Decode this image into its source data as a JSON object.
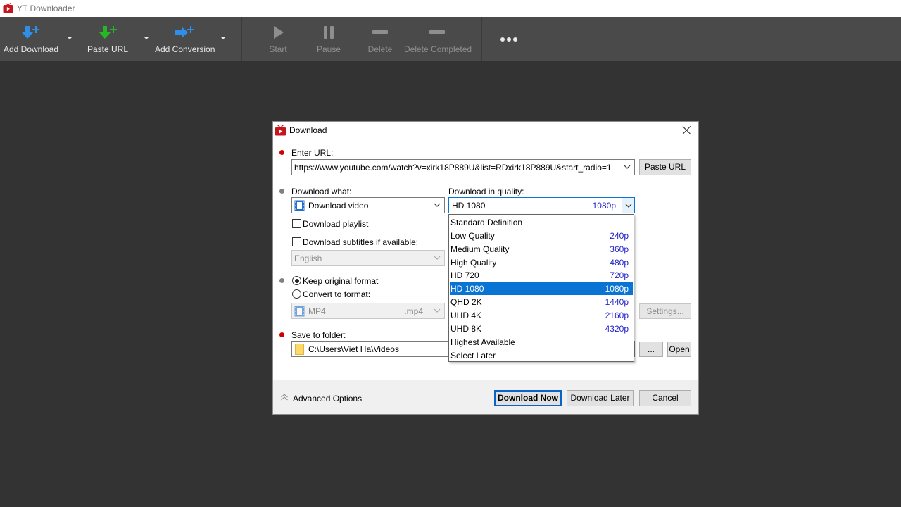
{
  "app": {
    "title": "YT Downloader",
    "icon": "youtube-tv-icon"
  },
  "toolbar": {
    "add_download": "Add Download",
    "paste_url": "Paste URL",
    "add_conversion": "Add Conversion",
    "start": "Start",
    "pause": "Pause",
    "delete": "Delete",
    "delete_completed": "Delete Completed"
  },
  "dialog": {
    "title": "Download",
    "enter_url_label": "Enter URL:",
    "url_value": "https://www.youtube.com/watch?v=xirk18P889U&list=RDxirk18P889U&start_radio=1",
    "paste_url_button": "Paste URL",
    "download_what_label": "Download what:",
    "download_what_value": "Download video",
    "download_quality_label": "Download in quality:",
    "quality_selected_name": "HD 1080",
    "quality_selected_res": "1080p",
    "download_playlist": "Download playlist",
    "download_subtitles": "Download subtitles if available:",
    "subtitle_language": "English",
    "keep_original_format": "Keep original format",
    "convert_to_format": "Convert to format:",
    "format_name": "MP4",
    "format_ext": ".mp4",
    "settings_button": "Settings...",
    "save_to_folder_label": "Save to folder:",
    "folder_path": "C:\\Users\\Viet Ha\\Videos",
    "browse_button": "...",
    "open_button": "Open",
    "advanced_options": "Advanced Options",
    "download_now": "Download Now",
    "download_later": "Download Later",
    "cancel": "Cancel"
  },
  "quality_options": [
    {
      "name": "Standard Definition",
      "res": ""
    },
    {
      "name": "Low Quality",
      "res": "240p"
    },
    {
      "name": "Medium Quality",
      "res": "360p"
    },
    {
      "name": "High Quality",
      "res": "480p"
    },
    {
      "name": "HD 720",
      "res": "720p"
    },
    {
      "name": "HD 1080",
      "res": "1080p",
      "selected": true
    },
    {
      "name": "QHD 2K",
      "res": "1440p"
    },
    {
      "name": "UHD 4K",
      "res": "2160p"
    },
    {
      "name": "UHD 8K",
      "res": "4320p"
    },
    {
      "name": "Highest Available",
      "res": ""
    },
    {
      "name": "Select Later",
      "res": ""
    }
  ],
  "colors": {
    "selection": "#0a74d4",
    "resolution_text": "#2323c8",
    "required_bullet": "#d00000"
  }
}
